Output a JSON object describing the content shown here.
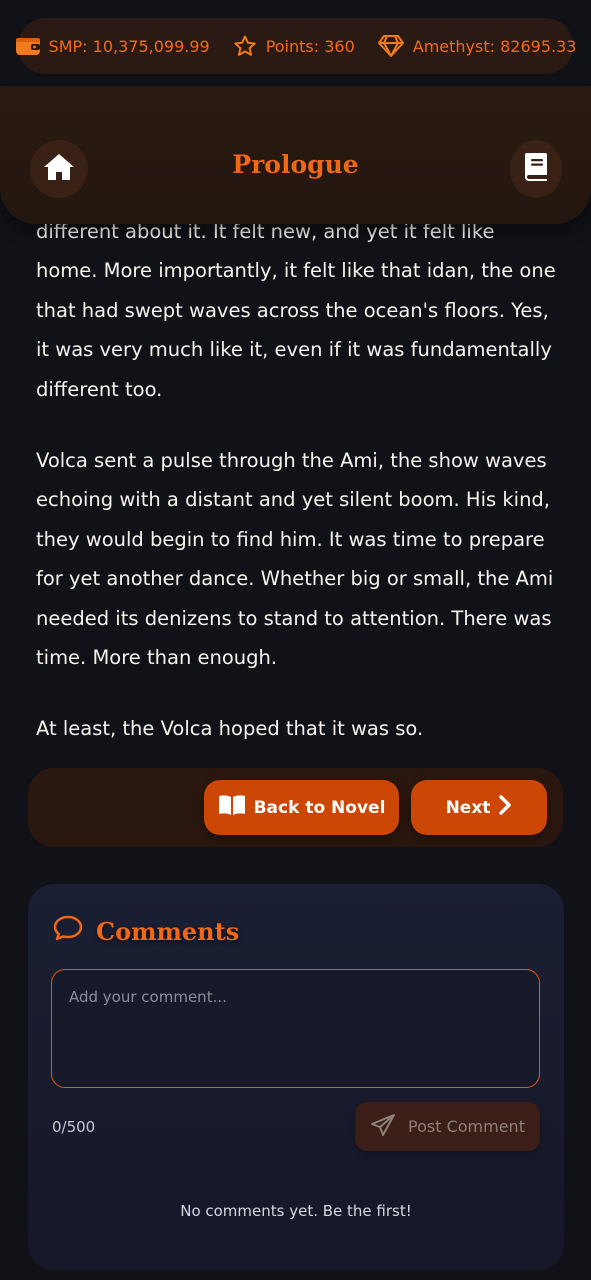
{
  "stats": {
    "smp": "SMP: 10,375,099.99",
    "points": "Points: 360",
    "amethyst": "Amethyst: 82695.33"
  },
  "header": {
    "title": "Prologue"
  },
  "story": {
    "paragraphs": [
      "different about it. It felt new, and yet it felt like home. More importantly, it felt like that idan, the one that had swept waves across the ocean's floors. Yes, it was very much like it, even if it was fundamentally different too.",
      "Volca sent a pulse through the Ami, the show waves echoing with a distant and yet silent boom. His kind, they would begin to find him. It was time to prepare for yet another dance. Whether big or small, the Ami needed its denizens to stand to attention. There was time. More than enough.",
      "At least, the Volca hoped that it was so."
    ]
  },
  "nav": {
    "back_label": "Back to Novel",
    "next_label": "Next"
  },
  "comments": {
    "title": "Comments",
    "placeholder": "Add your comment...",
    "value": "",
    "counter": "0/500",
    "post_label": "Post Comment",
    "empty_message": "No comments yet. Be the first!"
  },
  "colors": {
    "accent": "#f06718",
    "button": "#cc4706",
    "panel": "#2a1a13"
  },
  "icons": [
    "wallet-icon",
    "star-icon",
    "diamond-icon",
    "home-icon",
    "book-icon",
    "open-book-icon",
    "chevron-right-icon",
    "chat-bubble-icon",
    "send-icon"
  ]
}
